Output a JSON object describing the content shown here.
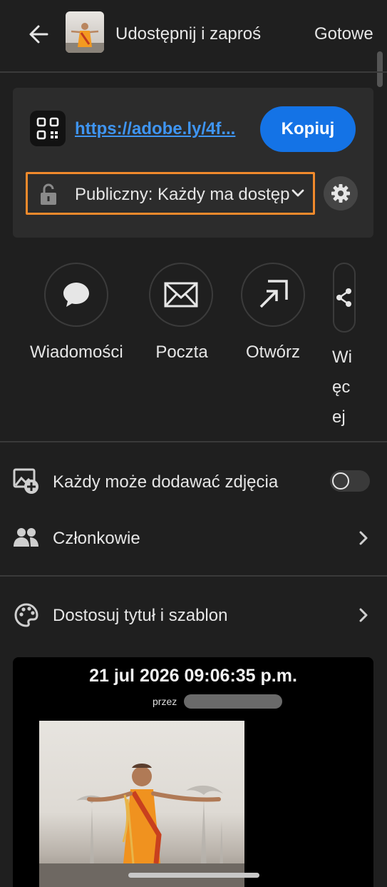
{
  "header": {
    "title": "Udostępnij i zaproś",
    "done_label": "Gotowe"
  },
  "share": {
    "link_text": "https://adobe.ly/4f...",
    "copy_label": "Kopiuj",
    "access_label": "Publiczny: Każdy ma dostęp"
  },
  "targets": [
    {
      "label": "Wiadomości",
      "icon": "speech-bubble-icon"
    },
    {
      "label": "Poczta",
      "icon": "mail-icon"
    },
    {
      "label": "Otwórz",
      "icon": "open-in-icon"
    },
    {
      "label": "Wi\nęc\nej",
      "icon": "share-icon"
    }
  ],
  "settings": {
    "add_photos_label": "Każdy może dodawać zdjęcia",
    "add_photos_enabled": false,
    "members_label": "Członkowie",
    "customize_label": "Dostosuj tytuł i szablon"
  },
  "preview": {
    "date": "21 jul 2026 09:06:35 p.m.",
    "by_label": "przez"
  },
  "colors": {
    "background": "#1f1f1f",
    "accent": "#1473e6",
    "link": "#3f95f2",
    "highlight": "#f08a2c"
  }
}
